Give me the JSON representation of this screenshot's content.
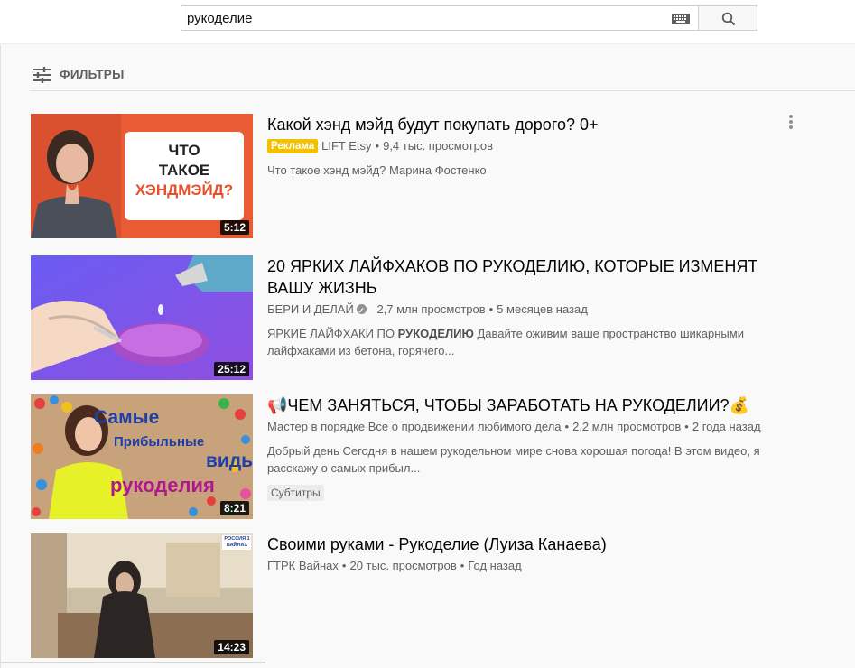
{
  "search": {
    "query": "рукоделие"
  },
  "filters": {
    "label": "ФИЛЬТРЫ"
  },
  "results": [
    {
      "title": "Какой хэнд мэйд будут покупать дорого? 0+",
      "ad_label": "Реклама",
      "channel": "LIFT Etsy",
      "views": "9,4 тыс. просмотров",
      "description": "Что такое хэнд мэйд? Марина Фостенко",
      "duration": "5:12",
      "thumb_text": [
        "ЧТО",
        "ТАКОЕ",
        "ХЭНДМЭЙД?"
      ],
      "colors": {
        "bg": "#ea5a32",
        "accent": "#e8502a"
      }
    },
    {
      "title": "20 ЯРКИХ ЛАЙФХАКОВ ПО РУКОДЕЛИЮ, КОТОРЫЕ ИЗМЕНЯТ ВАШУ ЖИЗНЬ",
      "channel": "БЕРИ И ДЕЛАЙ",
      "views": "2,7 млн просмотров",
      "age": "5 месяцев назад",
      "description_prefix": "ЯРКИЕ ЛАЙФХАКИ ПО ",
      "description_bold": "РУКОДЕЛИЮ",
      "description_rest": " Давайте оживим ваше пространство шикарными лайфхаками из бетона, горячего...",
      "duration": "25:12",
      "colors": {
        "bg": "#7b5cf0"
      }
    },
    {
      "title": "📢ЧЕМ ЗАНЯТЬСЯ, ЧТОБЫ ЗАРАБОТАТЬ НА РУКОДЕЛИИ?💰",
      "channel": "Мастер в порядке Все о продвижении любимого дела",
      "views": "2,2 млн просмотров",
      "age": "2 года назад",
      "description": "Добрый день Сегодня в нашем рукодельном мире снова хорошая погода! В этом видео, я расскажу о самых прибыл...",
      "badge": "Субтитры",
      "duration": "8:21",
      "thumb_text": [
        "Самые",
        "Прибыльные",
        "виды",
        "рукоделия"
      ],
      "colors": {
        "text_blue": "#1f3fa8",
        "text_purple": "#b0178f"
      }
    },
    {
      "title": "Своими руками - Рукоделие (Луиза Канаева)",
      "channel": "ГТРК Вайнах",
      "views": "20 тыс. просмотров",
      "age": "Год назад",
      "duration": "14:23",
      "thumb_text": [
        "РОССИЯ 1",
        "ВАЙНАХ"
      ]
    }
  ]
}
